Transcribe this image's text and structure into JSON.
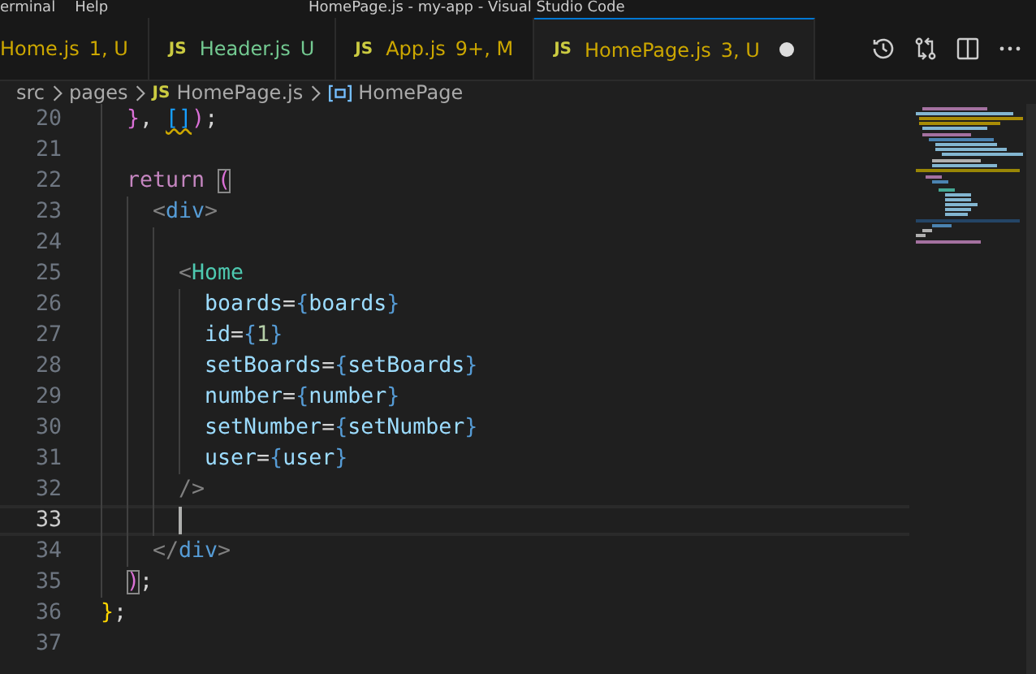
{
  "window": {
    "menu": [
      "erminal",
      "Help"
    ],
    "title": "HomePage.js - my-app - Visual Studio Code"
  },
  "tabs": [
    {
      "label": "Home.js",
      "badge": "1, U",
      "color": "#cca700",
      "selected": false
    },
    {
      "icon_text": "JS",
      "label": "Header.js",
      "badge": "U",
      "color": "#73c991",
      "selected": false
    },
    {
      "icon_text": "JS",
      "label": "App.js",
      "badge": "9+, M",
      "color": "#cca700",
      "selected": false
    },
    {
      "icon_text": "JS",
      "label": "HomePage.js",
      "badge": "3, U",
      "color": "#cca700",
      "selected": true,
      "dirty": true
    }
  ],
  "breadcrumb": [
    {
      "kind": "folder",
      "text": "src"
    },
    {
      "kind": "folder",
      "text": "pages"
    },
    {
      "kind": "file",
      "icon_text": "JS",
      "text": "HomePage.js"
    },
    {
      "kind": "symbol",
      "text": "HomePage"
    }
  ],
  "lines": [
    {
      "children": [
        {
          "number": "20",
          "tokens": [
            {
              "kind": "bracket",
              "text": "}"
            },
            {
              "kind": "punct",
              "text": ","
            },
            {
              "kind": "bracket2",
              "text": "[]",
              "squiggle": true,
              "space_before": true
            },
            {
              "kind": "bracket",
              "text": ")"
            },
            {
              "kind": "punct",
              "text": ";"
            }
          ]
        },
        {
          "number": "21"
        },
        {
          "number": "22",
          "tokens": [
            {
              "kind": "keyword",
              "text": "return"
            },
            {
              "kind": "bracket",
              "text": "(",
              "match": true,
              "space_before": true
            }
          ]
        },
        {
          "children": [
            {
              "number": "23",
              "tokens": [
                {
                  "kind": "tagpunct",
                  "text": "<"
                },
                {
                  "kind": "tag",
                  "text": "div"
                },
                {
                  "kind": "tagpunct",
                  "text": ">"
                }
              ]
            },
            {
              "children": [
                {
                  "number": "24"
                },
                {
                  "number": "25",
                  "tokens": [
                    {
                      "kind": "tagpunct",
                      "text": "<"
                    },
                    {
                      "kind": "component",
                      "text": "Home"
                    }
                  ]
                },
                {
                  "children": [
                    {
                      "number": "26",
                      "tokens": [
                        {
                          "kind": "attr",
                          "text": "boards"
                        },
                        {
                          "kind": "punct",
                          "text": "="
                        },
                        {
                          "kind": "jsxbrace",
                          "text": "{"
                        },
                        {
                          "kind": "var",
                          "text": "boards"
                        },
                        {
                          "kind": "jsxbrace",
                          "text": "}"
                        }
                      ]
                    },
                    {
                      "number": "27",
                      "tokens": [
                        {
                          "kind": "attr",
                          "text": "id"
                        },
                        {
                          "kind": "punct",
                          "text": "="
                        },
                        {
                          "kind": "jsxbrace",
                          "text": "{"
                        },
                        {
                          "kind": "number",
                          "text": "1"
                        },
                        {
                          "kind": "jsxbrace",
                          "text": "}"
                        }
                      ]
                    },
                    {
                      "number": "28",
                      "tokens": [
                        {
                          "kind": "attr",
                          "text": "setBoards"
                        },
                        {
                          "kind": "punct",
                          "text": "="
                        },
                        {
                          "kind": "jsxbrace",
                          "text": "{"
                        },
                        {
                          "kind": "var",
                          "text": "setBoards"
                        },
                        {
                          "kind": "jsxbrace",
                          "text": "}"
                        }
                      ]
                    },
                    {
                      "number": "29",
                      "tokens": [
                        {
                          "kind": "attr",
                          "text": "number"
                        },
                        {
                          "kind": "punct",
                          "text": "="
                        },
                        {
                          "kind": "jsxbrace",
                          "text": "{"
                        },
                        {
                          "kind": "var",
                          "text": "number"
                        },
                        {
                          "kind": "jsxbrace",
                          "text": "}"
                        }
                      ]
                    },
                    {
                      "number": "30",
                      "tokens": [
                        {
                          "kind": "attr",
                          "text": "setNumber"
                        },
                        {
                          "kind": "punct",
                          "text": "="
                        },
                        {
                          "kind": "jsxbrace",
                          "text": "{"
                        },
                        {
                          "kind": "var",
                          "text": "setNumber"
                        },
                        {
                          "kind": "jsxbrace",
                          "text": "}"
                        }
                      ]
                    },
                    {
                      "number": "31",
                      "tokens": [
                        {
                          "kind": "attr",
                          "text": "user"
                        },
                        {
                          "kind": "punct",
                          "text": "="
                        },
                        {
                          "kind": "jsxbrace",
                          "text": "{"
                        },
                        {
                          "kind": "var",
                          "text": "user"
                        },
                        {
                          "kind": "jsxbrace",
                          "text": "}"
                        }
                      ]
                    }
                  ]
                },
                {
                  "number": "32",
                  "tokens": [
                    {
                      "kind": "tagpunct",
                      "text": "/>"
                    }
                  ]
                },
                {
                  "number": "33",
                  "current": true
                }
              ]
            },
            {
              "number": "34",
              "tokens": [
                {
                  "kind": "tagpunct",
                  "text": "</"
                },
                {
                  "kind": "tag",
                  "text": "div"
                },
                {
                  "kind": "tagpunct",
                  "text": ">"
                }
              ]
            }
          ]
        },
        {
          "number": "35",
          "tokens": [
            {
              "kind": "bracket",
              "text": ")",
              "match": true
            },
            {
              "kind": "punct",
              "text": ";"
            }
          ]
        }
      ]
    },
    {
      "number": "36",
      "tokens": [
        {
          "kind": "bracket3",
          "text": "}"
        },
        {
          "kind": "punct",
          "text": ";"
        }
      ]
    },
    {
      "number": "37"
    }
  ]
}
